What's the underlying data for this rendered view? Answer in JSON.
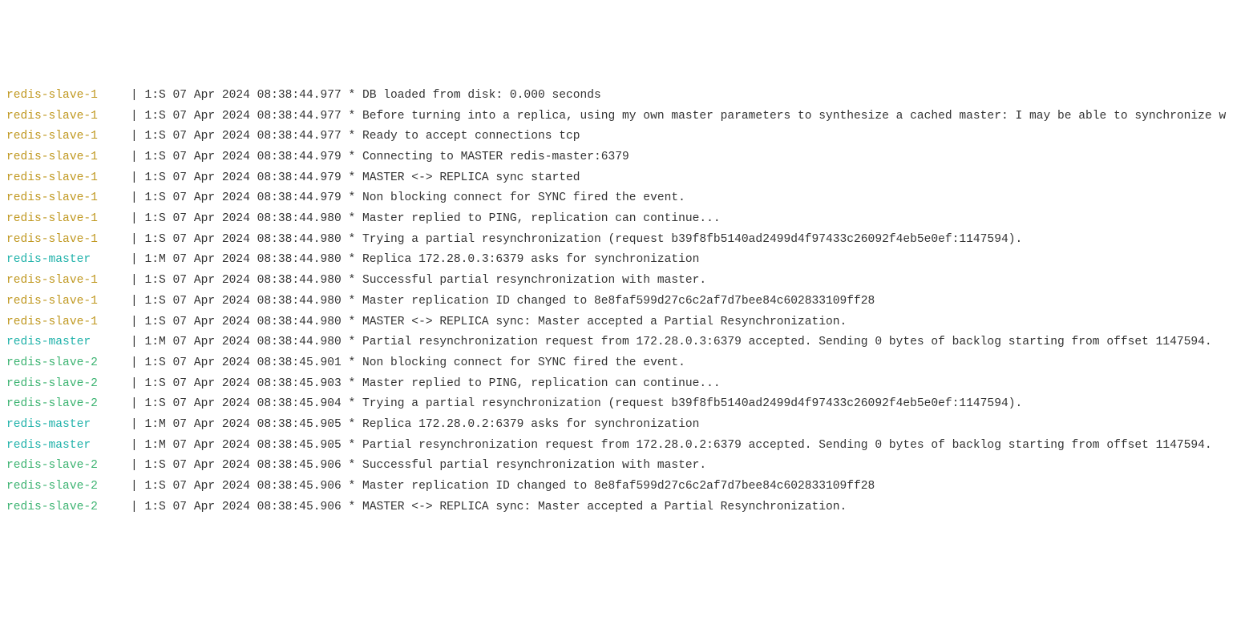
{
  "separator": "| ",
  "logs": [
    {
      "service": "redis-slave-1",
      "cls": "slave1",
      "msg": "1:S 07 Apr 2024 08:38:44.977 * DB loaded from disk: 0.000 seconds"
    },
    {
      "service": "redis-slave-1",
      "cls": "slave1",
      "msg": "1:S 07 Apr 2024 08:38:44.977 * Before turning into a replica, using my own master parameters to synthesize a cached master: I may be able to synchronize w"
    },
    {
      "service": "redis-slave-1",
      "cls": "slave1",
      "msg": "1:S 07 Apr 2024 08:38:44.977 * Ready to accept connections tcp"
    },
    {
      "service": "redis-slave-1",
      "cls": "slave1",
      "msg": "1:S 07 Apr 2024 08:38:44.979 * Connecting to MASTER redis-master:6379"
    },
    {
      "service": "redis-slave-1",
      "cls": "slave1",
      "msg": "1:S 07 Apr 2024 08:38:44.979 * MASTER <-> REPLICA sync started"
    },
    {
      "service": "redis-slave-1",
      "cls": "slave1",
      "msg": "1:S 07 Apr 2024 08:38:44.979 * Non blocking connect for SYNC fired the event."
    },
    {
      "service": "redis-slave-1",
      "cls": "slave1",
      "msg": "1:S 07 Apr 2024 08:38:44.980 * Master replied to PING, replication can continue..."
    },
    {
      "service": "redis-slave-1",
      "cls": "slave1",
      "msg": "1:S 07 Apr 2024 08:38:44.980 * Trying a partial resynchronization (request b39f8fb5140ad2499d4f97433c26092f4eb5e0ef:1147594)."
    },
    {
      "service": "redis-master",
      "cls": "master",
      "msg": "1:M 07 Apr 2024 08:38:44.980 * Replica 172.28.0.3:6379 asks for synchronization"
    },
    {
      "service": "redis-slave-1",
      "cls": "slave1",
      "msg": "1:S 07 Apr 2024 08:38:44.980 * Successful partial resynchronization with master."
    },
    {
      "service": "redis-slave-1",
      "cls": "slave1",
      "msg": "1:S 07 Apr 2024 08:38:44.980 * Master replication ID changed to 8e8faf599d27c6c2af7d7bee84c602833109ff28"
    },
    {
      "service": "redis-slave-1",
      "cls": "slave1",
      "msg": "1:S 07 Apr 2024 08:38:44.980 * MASTER <-> REPLICA sync: Master accepted a Partial Resynchronization."
    },
    {
      "service": "redis-master",
      "cls": "master",
      "msg": "1:M 07 Apr 2024 08:38:44.980 * Partial resynchronization request from 172.28.0.3:6379 accepted. Sending 0 bytes of backlog starting from offset 1147594."
    },
    {
      "service": "redis-slave-2",
      "cls": "slave2",
      "msg": "1:S 07 Apr 2024 08:38:45.901 * Non blocking connect for SYNC fired the event."
    },
    {
      "service": "redis-slave-2",
      "cls": "slave2",
      "msg": "1:S 07 Apr 2024 08:38:45.903 * Master replied to PING, replication can continue..."
    },
    {
      "service": "redis-slave-2",
      "cls": "slave2",
      "msg": "1:S 07 Apr 2024 08:38:45.904 * Trying a partial resynchronization (request b39f8fb5140ad2499d4f97433c26092f4eb5e0ef:1147594)."
    },
    {
      "service": "redis-master",
      "cls": "master",
      "msg": "1:M 07 Apr 2024 08:38:45.905 * Replica 172.28.0.2:6379 asks for synchronization"
    },
    {
      "service": "redis-master",
      "cls": "master",
      "msg": "1:M 07 Apr 2024 08:38:45.905 * Partial resynchronization request from 172.28.0.2:6379 accepted. Sending 0 bytes of backlog starting from offset 1147594."
    },
    {
      "service": "redis-slave-2",
      "cls": "slave2",
      "msg": "1:S 07 Apr 2024 08:38:45.906 * Successful partial resynchronization with master."
    },
    {
      "service": "redis-slave-2",
      "cls": "slave2",
      "msg": "1:S 07 Apr 2024 08:38:45.906 * Master replication ID changed to 8e8faf599d27c6c2af7d7bee84c602833109ff28"
    },
    {
      "service": "redis-slave-2",
      "cls": "slave2",
      "msg": "1:S 07 Apr 2024 08:38:45.906 * MASTER <-> REPLICA sync: Master accepted a Partial Resynchronization."
    }
  ]
}
